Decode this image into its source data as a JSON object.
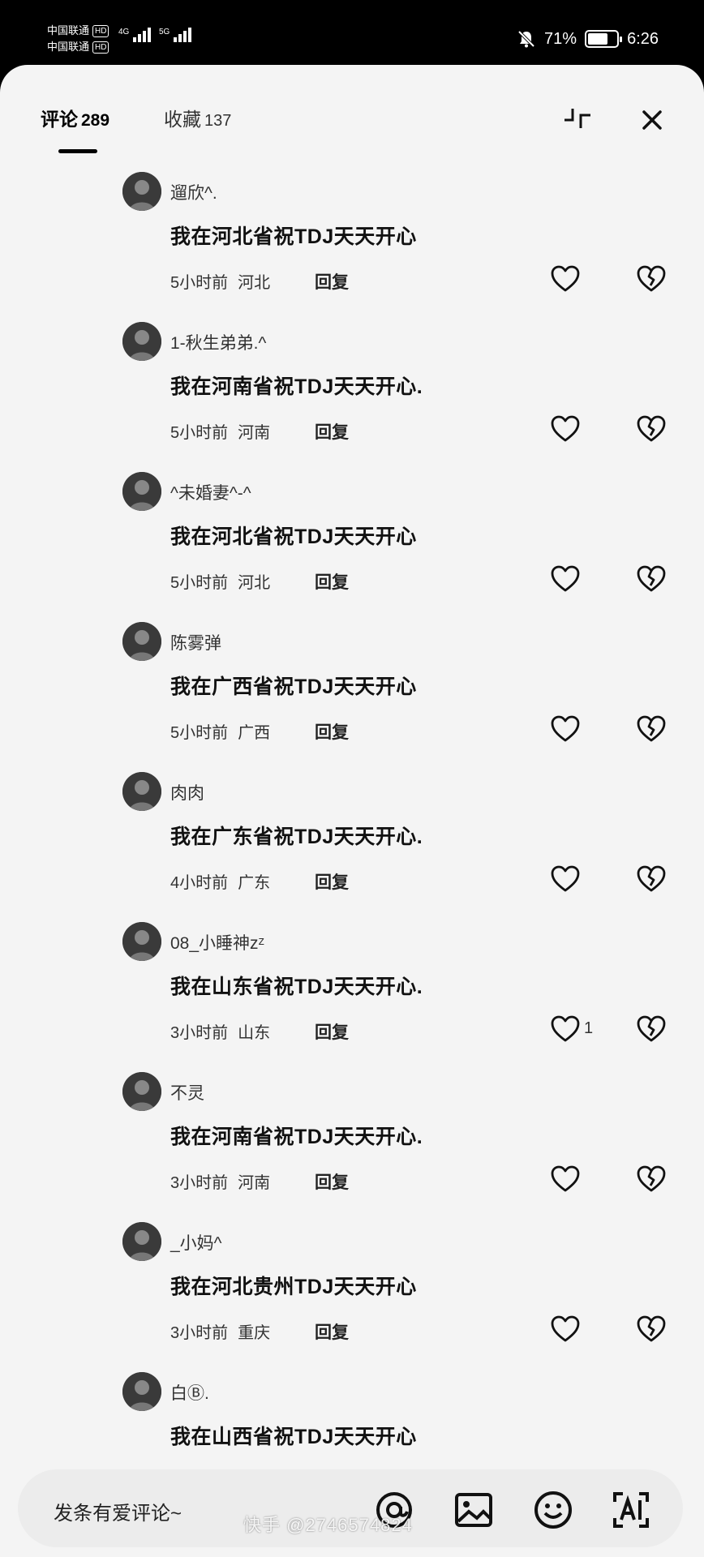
{
  "status_bar": {
    "carrier1": "中国联通",
    "carrier2": "中国联通",
    "hd": "HD",
    "net1": "4G",
    "net2": "5G",
    "battery_pct": "71%",
    "battery_level": 0.71,
    "time": "6:26"
  },
  "header": {
    "comments_tab_label": "评论",
    "comments_count": "289",
    "favorites_tab_label": "收藏",
    "favorites_count": "137",
    "collapse_icon": "collapse-icon",
    "close_icon": "close-icon"
  },
  "comments": [
    {
      "username": "遛欣^.",
      "text": "我在河北省祝TDJ天天开心",
      "time": "5小时前",
      "location": "河北",
      "reply": "回复",
      "likes": ""
    },
    {
      "username": "1-秋生弟弟.^",
      "text": "我在河南省祝TDJ天天开心.",
      "time": "5小时前",
      "location": "河南",
      "reply": "回复",
      "likes": ""
    },
    {
      "username": "^未婚妻^-^",
      "text": "我在河北省祝TDJ天天开心",
      "time": "5小时前",
      "location": "河北",
      "reply": "回复",
      "likes": ""
    },
    {
      "username": "陈雾弹",
      "text": "我在广西省祝TDJ天天开心",
      "time": "5小时前",
      "location": "广西",
      "reply": "回复",
      "likes": ""
    },
    {
      "username": "肉肉",
      "text": "我在广东省祝TDJ天天开心.",
      "time": "4小时前",
      "location": "广东",
      "reply": "回复",
      "likes": ""
    },
    {
      "username": "08_小睡神zᶻ",
      "text": "我在山东省祝TDJ天天开心.",
      "time": "3小时前",
      "location": "山东",
      "reply": "回复",
      "likes": "1"
    },
    {
      "username": "不灵",
      "text": "我在河南省祝TDJ天天开心.",
      "time": "3小时前",
      "location": "河南",
      "reply": "回复",
      "likes": ""
    },
    {
      "username": "_小妈^",
      "text": "我在河北贵州TDJ天天开心",
      "time": "3小时前",
      "location": "重庆",
      "reply": "回复",
      "likes": ""
    },
    {
      "username": "白Ⓑ.",
      "text": "我在山西省祝TDJ天天开心",
      "time": "",
      "location": "",
      "reply": "",
      "likes": ""
    }
  ],
  "input": {
    "placeholder": "发条有爱评论~",
    "icons": [
      "at-icon",
      "image-icon",
      "emoji-icon",
      "ai-icon"
    ]
  },
  "watermark": "快手 @2746574824"
}
